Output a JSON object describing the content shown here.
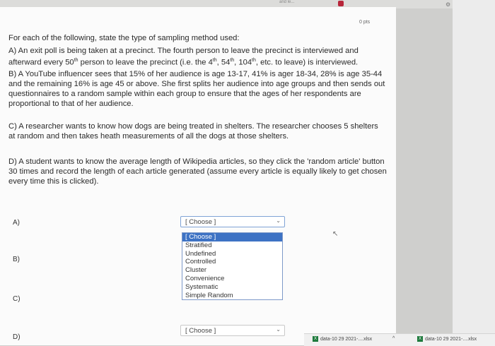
{
  "topbar": {
    "tab_text": "and le..."
  },
  "points": "0 pts",
  "question": {
    "intro": "For each of the following, state the type of sampling method used:",
    "items": [
      {
        "text_before": "A) An exit poll is being taken at a precinct. The fourth person to leave the precinct is interviewed and afterward every 50",
        "sup1": "th",
        "text_mid": " person to leave the precinct (i.e. the 4",
        "sup2": "th",
        "text_mid2": ", 54",
        "sup3": "th",
        "text_mid3": ", 104",
        "sup4": "th",
        "text_after": ", etc. to leave) is interviewed."
      },
      "B) A YouTube influencer sees that 15% of her audience is age 13-17, 41% is ager 18-34, 28% is age 35-44 and the remaining 16% is age 45 or above. She first splits her audience into age groups and then sends out questionnaires to a random sample within each group to ensure that the ages of her respondents are proportional to that of her audience.",
      "C) A researcher wants to know how dogs are being treated in shelters. The researcher chooses 5 shelters at random and then takes heath measurements of all the dogs at those shelters.",
      "D) A student wants to know the average length of Wikipedia articles, so they click the 'random article' button 30 times and record the length of each article generated (assume every article is equally likely to get chosen every time this is clicked)."
    ]
  },
  "answers": {
    "labels": [
      "A)",
      "B)",
      "C)",
      "D)"
    ],
    "a_value": "[ Choose ]",
    "d_value": "[ Choose ]"
  },
  "dropdown_options": [
    "[ Choose ]",
    "Stratified",
    "Undefined",
    "Controlled",
    "Cluster",
    "Convenience",
    "Systematic",
    "Simple Random"
  ],
  "downloads": [
    {
      "name": "data-10 29 2021-....xlsx"
    },
    {
      "name": "data-10 29 2021-....xlsx"
    }
  ],
  "colors": {
    "selected": "#3d72c4",
    "excel": "#1e7a3c"
  }
}
